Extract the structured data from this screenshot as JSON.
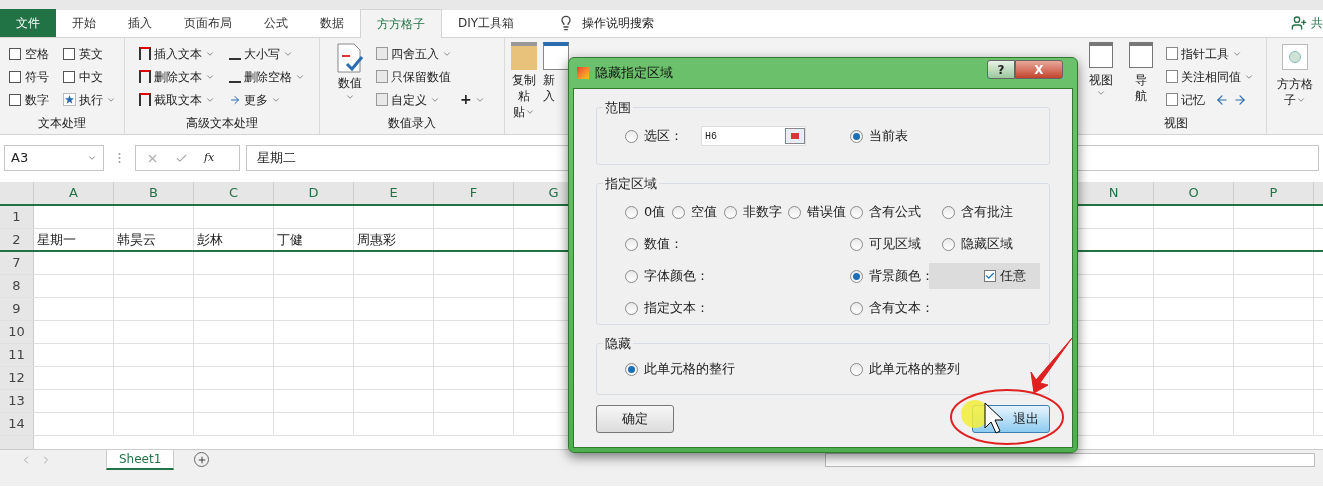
{
  "tabs": [
    {
      "label": "文件",
      "kind": "file",
      "selected": false
    },
    {
      "label": "开始",
      "kind": "tab",
      "selected": false
    },
    {
      "label": "插入",
      "kind": "tab",
      "selected": false
    },
    {
      "label": "页面布局",
      "kind": "tab",
      "selected": false
    },
    {
      "label": "公式",
      "kind": "tab",
      "selected": false
    },
    {
      "label": "数据",
      "kind": "tab",
      "selected": false
    },
    {
      "label": "方方格子",
      "kind": "tab",
      "selected": true
    },
    {
      "label": "DIY工具箱",
      "kind": "tab",
      "selected": false
    }
  ],
  "tell_me": "操作说明搜索",
  "share": "共",
  "ribbon": {
    "text_group": {
      "label": "文本处理",
      "checkboxes": [
        {
          "label": "空格",
          "checked": false
        },
        {
          "label": "符号",
          "checked": false
        },
        {
          "label": "数字",
          "checked": false
        },
        {
          "label": "英文",
          "checked": false
        },
        {
          "label": "中文",
          "checked": false
        }
      ],
      "run": "执行"
    },
    "advanced_group": {
      "label": "高级文本处理",
      "buttons": [
        "插入文本",
        "删除文本",
        "截取文本",
        "大小写",
        "删除空格",
        "更多"
      ]
    },
    "number_group": {
      "label": "数值录入",
      "big_button": "数值",
      "buttons": [
        "四舍五入",
        "只保留数值",
        "自定义"
      ],
      "plus": "+"
    },
    "paste_buttons": [
      [
        "复制粘",
        "贴"
      ],
      [
        "新",
        "入"
      ]
    ],
    "view_group": {
      "label": "视图",
      "big_buttons": [
        [
          "视图"
        ],
        [
          "导",
          "航"
        ]
      ],
      "buttons": [
        "指针工具",
        "关注相同值",
        "记忆"
      ]
    },
    "ffgz_button": [
      "方方格",
      "子"
    ]
  },
  "formula_bar": {
    "name_box": "A3",
    "fx": "fx",
    "value": "星期二"
  },
  "sheet": {
    "columns_left": [
      "A",
      "B",
      "C",
      "D",
      "E",
      "F",
      "G"
    ],
    "columns_right": [
      "N",
      "O",
      "P"
    ],
    "rows": [
      {
        "header": "1"
      },
      {
        "header": "2",
        "cells": [
          "星期一",
          "韩昊云",
          "彭林",
          "丁健",
          "周惠彩"
        ]
      },
      {
        "header": "7"
      },
      {
        "header": "8"
      },
      {
        "header": "9"
      },
      {
        "header": "10"
      },
      {
        "header": "11"
      },
      {
        "header": "12"
      },
      {
        "header": "13"
      },
      {
        "header": "14"
      }
    ]
  },
  "sheet_tabs": [
    {
      "label": "Sheet1",
      "selected": true
    }
  ],
  "dialog": {
    "title": "隐藏指定区域",
    "help": "?",
    "close": "X",
    "range": {
      "legend": "范围",
      "options": [
        {
          "label": "选区：",
          "selected": false,
          "value": "H6"
        },
        {
          "label": "当前表",
          "selected": true
        }
      ]
    },
    "area": {
      "legend": "指定区域",
      "rows": [
        [
          {
            "label": "0值",
            "selected": false
          },
          {
            "label": "空值",
            "selected": false
          },
          {
            "label": "非数字",
            "selected": false
          },
          {
            "label": "错误值",
            "selected": false
          },
          {
            "label": "含有公式",
            "selected": false
          },
          {
            "label": "含有批注",
            "selected": false
          }
        ],
        [
          {
            "label": "数值：",
            "selected": false
          },
          null,
          null,
          null,
          {
            "label": "可见区域",
            "selected": false
          },
          {
            "label": "隐藏区域",
            "selected": false
          }
        ],
        [
          {
            "label": "字体颜色：",
            "selected": false
          },
          null,
          null,
          null,
          {
            "label": "背景颜色：",
            "selected": true
          }
        ],
        [
          {
            "label": "指定文本：",
            "selected": false
          },
          null,
          null,
          null,
          {
            "label": "含有文本：",
            "selected": false
          }
        ]
      ],
      "any": {
        "label": "任意",
        "checked": true
      }
    },
    "hide": {
      "legend": "隐藏",
      "options": [
        {
          "label": "此单元格的整行",
          "selected": true
        },
        {
          "label": "此单元格的整列",
          "selected": false
        }
      ]
    },
    "ok": "确定",
    "exit": "退出"
  }
}
